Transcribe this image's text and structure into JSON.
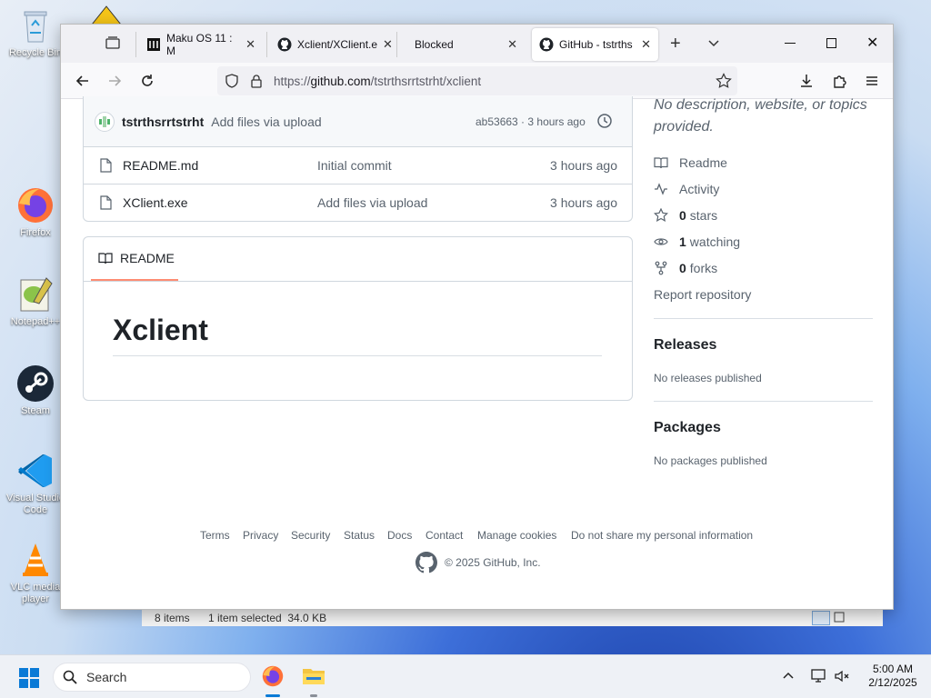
{
  "desktop": {
    "icons": [
      {
        "label": "Recycle Bin"
      },
      {
        "label": "Firefox"
      },
      {
        "label": "Notepad++"
      },
      {
        "label": "Steam"
      },
      {
        "label": "Visual Studio Code"
      },
      {
        "label": "VLC media player"
      }
    ]
  },
  "browser": {
    "tabs": [
      {
        "label": "Maku OS 11 : M"
      },
      {
        "label": "Xclient/XClient.e"
      },
      {
        "label": "Blocked"
      },
      {
        "label": "GitHub - tstrths"
      }
    ],
    "url": {
      "scheme": "https://",
      "host": "github.com",
      "path": "/tstrthsrrtstrht/xclient"
    }
  },
  "repo": {
    "commit": {
      "author": "tstrthsrrtstrht",
      "message": "Add files via upload",
      "hash_time": "ab53663 · 3 hours ago"
    },
    "files": [
      {
        "name": "README.md",
        "message": "Initial commit",
        "time": "3 hours ago"
      },
      {
        "name": "XClient.exe",
        "message": "Add files via upload",
        "time": "3 hours ago"
      }
    ],
    "readme_tab": "README",
    "readme_title": "Xclient"
  },
  "sidebar": {
    "about_line1": "No description, website, or topics",
    "about_line2": "provided.",
    "readme": "Readme",
    "activity": "Activity",
    "stars_count": "0",
    "stars_label": "stars",
    "watching_count": "1",
    "watching_label": "watching",
    "forks_count": "0",
    "forks_label": "forks",
    "report": "Report repository",
    "releases_title": "Releases",
    "releases_text": "No releases published",
    "packages_title": "Packages",
    "packages_text": "No packages published"
  },
  "footer": {
    "links": [
      "Terms",
      "Privacy",
      "Security",
      "Status",
      "Docs",
      "Contact",
      "Manage cookies",
      "Do not share my personal information"
    ],
    "copyright": "© 2025 GitHub, Inc."
  },
  "explorer": {
    "items": "8 items",
    "selected": "1 item selected  34.0 KB"
  },
  "taskbar": {
    "search_placeholder": "Search",
    "time": "5:00 AM",
    "date": "2/12/2025"
  }
}
